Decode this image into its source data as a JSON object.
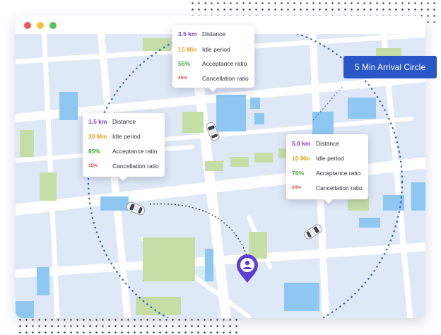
{
  "window": {
    "traffic_lights": {
      "close": "#ea5b5b",
      "minimize": "#f4c13d",
      "maximize": "#57c25c"
    }
  },
  "map": {
    "colors": {
      "land": "#dfe8f7",
      "road": "#ffffff",
      "park": "#c5dea5",
      "water": "#8ec7f1",
      "circle": "#2f5fd1",
      "route": "#2b2b2b",
      "pin": "#5e3fd3"
    },
    "arrival_circle_label": "5 Min Arrival Circle",
    "icons": [
      "car-icon",
      "location-pin-icon",
      "user-icon"
    ]
  },
  "drivers": [
    {
      "rows": [
        {
          "value": "3.5 km",
          "label": "Distance",
          "color": "#7a3fc8"
        },
        {
          "value": "15 Min",
          "label": "Idle period",
          "color": "#e8a21a"
        },
        {
          "value": "55%",
          "label": "Acceptance ratio",
          "color": "#44a83a"
        },
        {
          "value": "45%",
          "label": "Cancellation ratio",
          "color": "#e04848"
        }
      ]
    },
    {
      "rows": [
        {
          "value": "1.5 km",
          "label": "Distance",
          "color": "#7a3fc8"
        },
        {
          "value": "20 Min",
          "label": "Idle period",
          "color": "#e8a21a"
        },
        {
          "value": "85%",
          "label": "Acceptance ratio",
          "color": "#44a83a"
        },
        {
          "value": "15%",
          "label": "Cancellation ratio",
          "color": "#e04848"
        }
      ]
    },
    {
      "rows": [
        {
          "value": "5.0 km",
          "label": "Distance",
          "color": "#7a3fc8"
        },
        {
          "value": "10 Min",
          "label": "Idle period",
          "color": "#e8a21a"
        },
        {
          "value": "76%",
          "label": "Acceptance ratio",
          "color": "#44a83a"
        },
        {
          "value": "24%",
          "label": "Cancellation ratio",
          "color": "#e04848"
        }
      ]
    }
  ]
}
